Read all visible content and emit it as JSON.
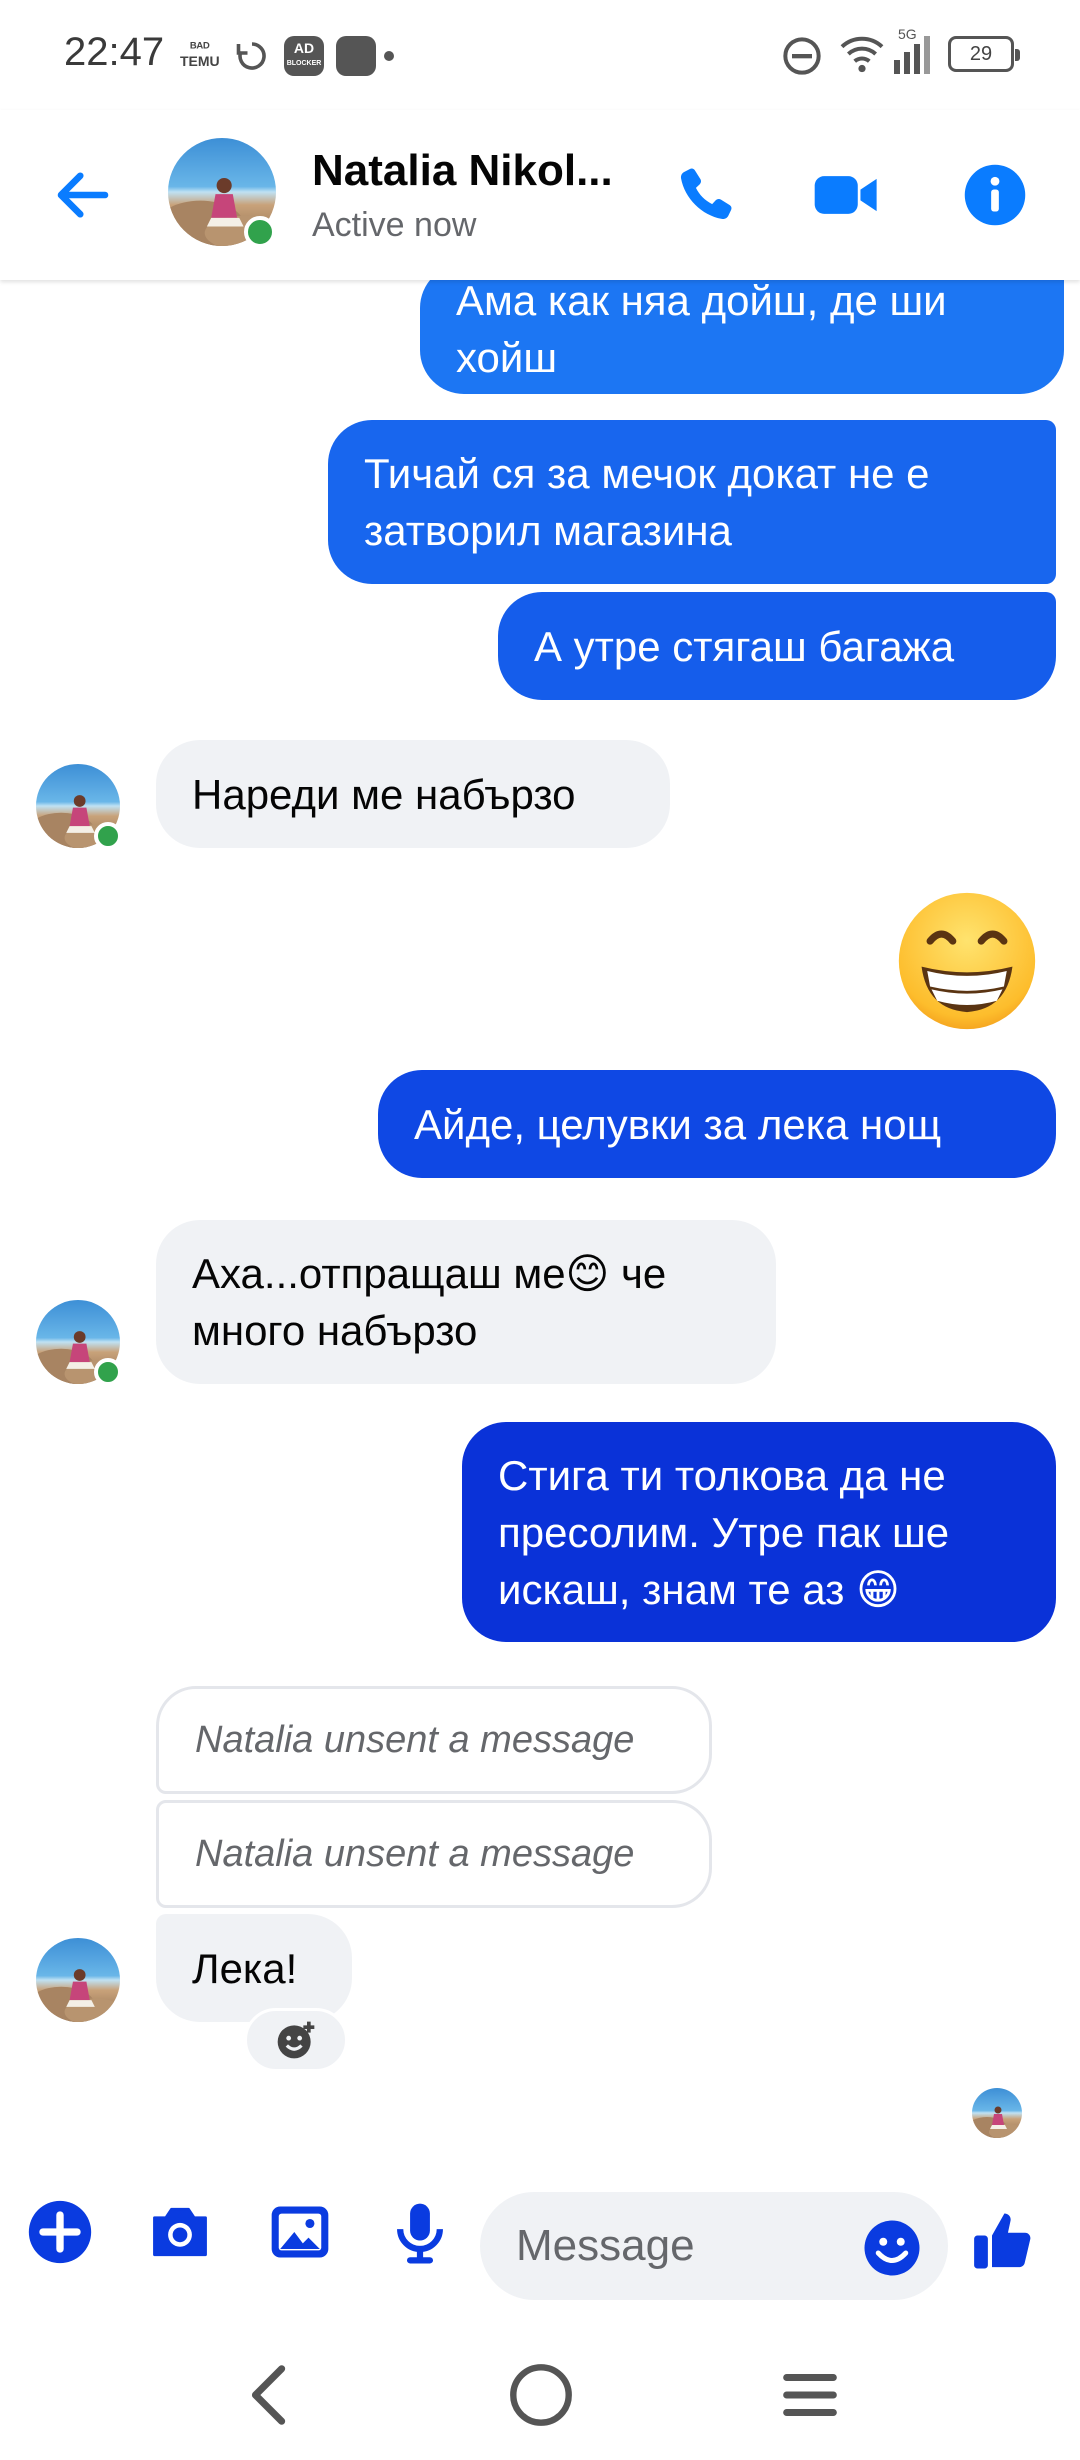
{
  "status_bar": {
    "time": "22:47",
    "temu_label": "ᴮᴬᴰᴳᴱ TEMU",
    "adblock_label": "AD",
    "adblock_sub": "BLOCKER",
    "network": "5G",
    "battery": "29"
  },
  "header": {
    "contact_name": "Natalia Nikol...",
    "status": "Active now"
  },
  "colors": {
    "accent": "#0a7cff",
    "bubble_top": "#1877f2",
    "bubble_bottom": "#0a2fd6",
    "incoming_bg": "#f0f2f5",
    "online": "#31a24c"
  },
  "messages": {
    "m1": "Ама как няа дойш, де ши хойш",
    "m2": "Тичай ся за мечок докат не е затворил магазина",
    "m3": "А утре стягаш багажа",
    "m4": "Нареди ме набързо",
    "m5_emoji": "😁",
    "m6": "Айде, целувки за лека нощ",
    "m7": "Аха...отпращаш ме😊 че много набързо",
    "m8": "Стига ти толкова да не пресолим. Утре пак ше искаш, знам те аз 😁",
    "m9": "Natalia unsent a message",
    "m10": "Natalia unsent a message",
    "m11": "Лека!"
  },
  "composer": {
    "placeholder": "Message"
  },
  "icons": [
    "back-arrow-icon",
    "phone-icon",
    "video-camera-icon",
    "info-icon",
    "plus-icon",
    "camera-icon",
    "gallery-icon",
    "microphone-icon",
    "emoji-icon",
    "thumbs-up-icon",
    "add-reaction-icon"
  ]
}
